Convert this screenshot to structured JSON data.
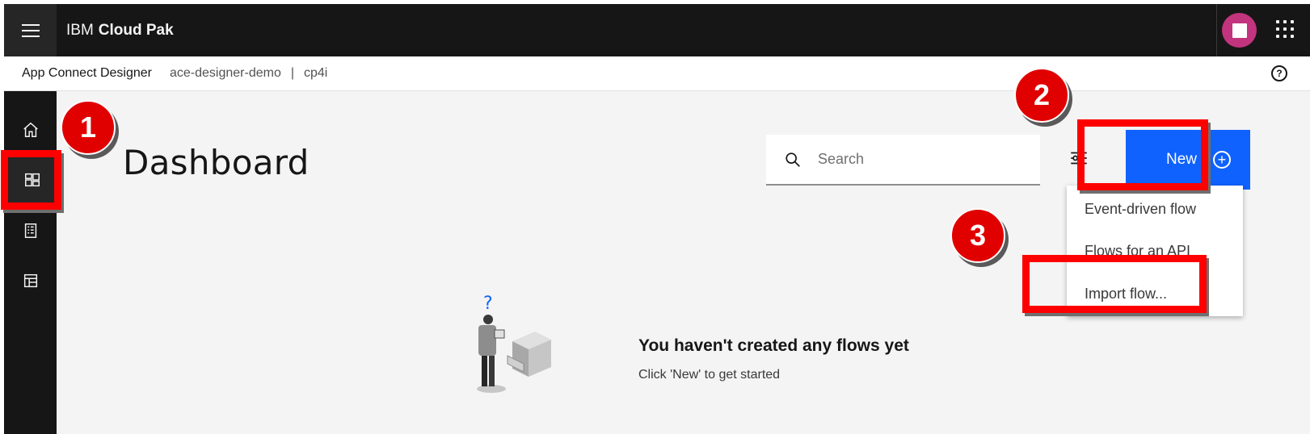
{
  "header": {
    "brand_prefix": "IBM",
    "brand_product": "Cloud Pak",
    "menu_icon": "hamburger-menu-icon",
    "avatar_icon": "user-avatar",
    "switcher_icon": "app-switcher-icon",
    "colors": {
      "bar": "#161616",
      "avatar": "#c2347e"
    }
  },
  "subheader": {
    "app_name": "App Connect Designer",
    "instance": "ace-designer-demo",
    "separator": "|",
    "namespace": "cp4i",
    "help_icon": "help-icon"
  },
  "sidebar": {
    "items": [
      {
        "icon": "home-icon",
        "active": false
      },
      {
        "icon": "dashboard-icon",
        "active": true
      },
      {
        "icon": "catalog-icon",
        "active": false
      },
      {
        "icon": "templates-icon",
        "active": false
      }
    ]
  },
  "main": {
    "title": "Dashboard",
    "search": {
      "placeholder": "Search",
      "value": ""
    },
    "filter_icon": "settings-adjust-icon",
    "new_button": {
      "label": "New",
      "icon": "add-circle-icon",
      "color": "#0f62fe"
    },
    "new_menu": [
      {
        "label": "Event-driven flow"
      },
      {
        "label": "Flows for an API"
      },
      {
        "label": "Import flow..."
      }
    ],
    "empty_state": {
      "title": "You haven't created any flows yet",
      "subtitle": "Click 'New' to get started",
      "question_mark": "?"
    }
  },
  "annotations": {
    "badges": [
      "1",
      "2",
      "3"
    ],
    "color": "#ff0000"
  }
}
